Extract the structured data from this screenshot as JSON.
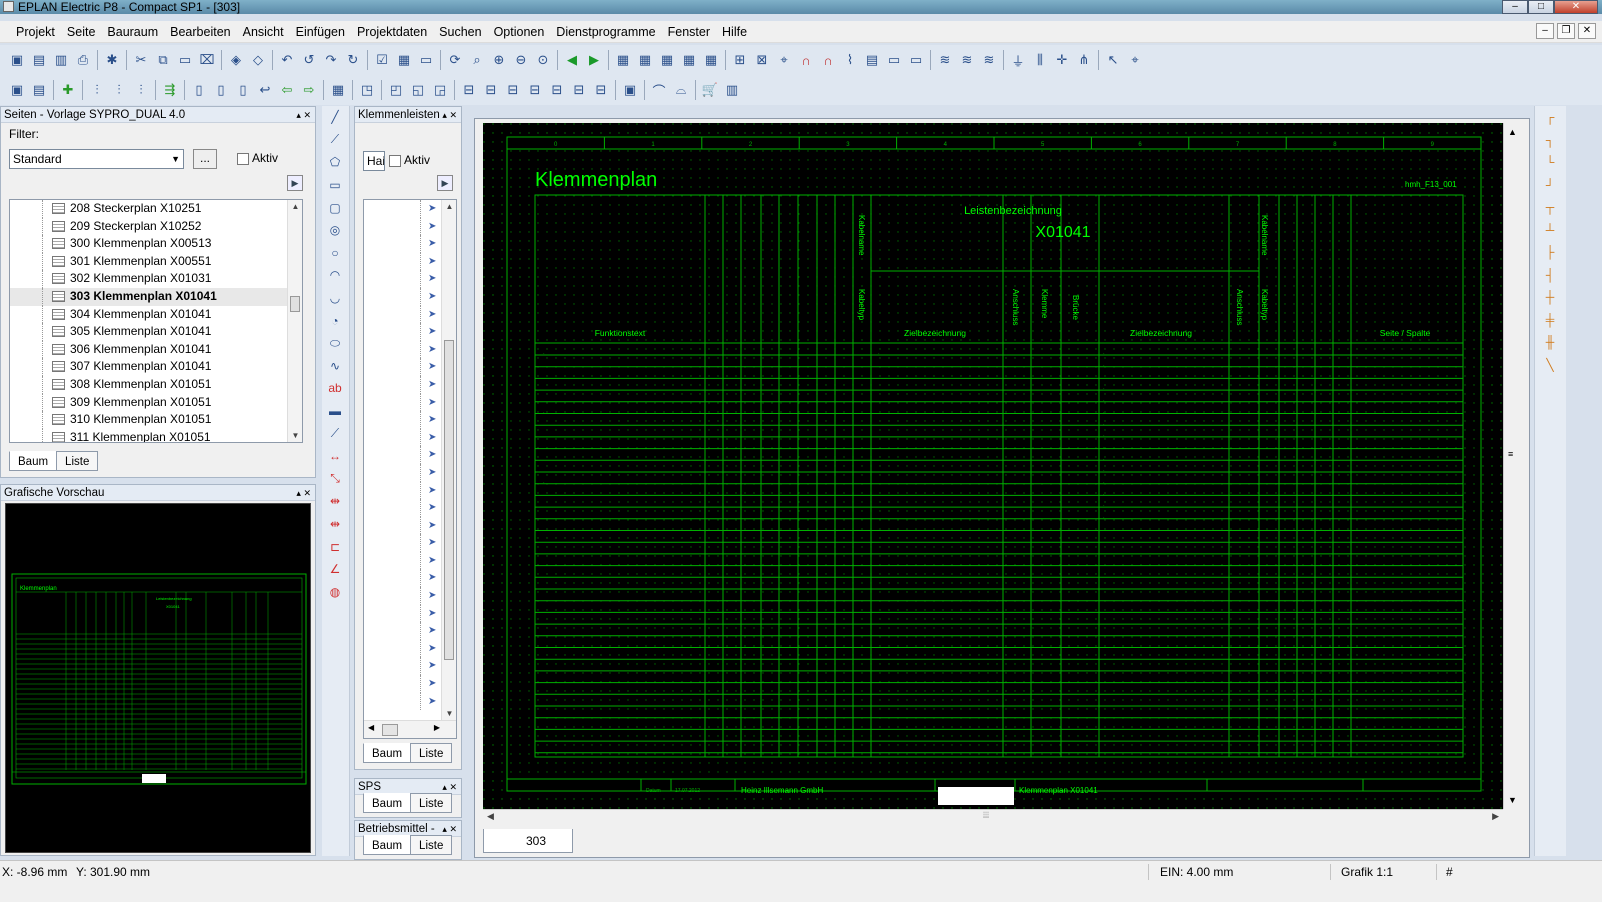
{
  "window": {
    "title": "EPLAN Electric P8 - Compact SP1 - [303]"
  },
  "menubar": {
    "items": [
      "Projekt",
      "Seite",
      "Bauraum",
      "Bearbeiten",
      "Ansicht",
      "Einfügen",
      "Projektdaten",
      "Suchen",
      "Optionen",
      "Dienstprogramme",
      "Fenster",
      "Hilfe"
    ]
  },
  "pages_panel": {
    "title": "Seiten - Vorlage SYPRO_DUAL 4.0",
    "filter_label": "Filter:",
    "filter_value": "Standard",
    "filter_more": "...",
    "active_label": "Aktiv",
    "items": [
      "208 Steckerplan X10251",
      "209 Steckerplan X10252",
      "300 Klemmenplan X00513",
      "301 Klemmenplan X00551",
      "302 Klemmenplan X01031",
      "303 Klemmenplan X01041",
      "304 Klemmenplan X01041",
      "305 Klemmenplan X01041",
      "306 Klemmenplan X01041",
      "307 Klemmenplan X01041",
      "308 Klemmenplan X01051",
      "309 Klemmenplan X01051",
      "310 Klemmenplan X01051",
      "311 Klemmenplan X01051"
    ],
    "selected_index": 5,
    "tabs": [
      "Baum",
      "Liste"
    ]
  },
  "preview_panel": {
    "title": "Grafische Vorschau",
    "mini_title": "Klemmenplan",
    "mini_heading": "Leistenbezeichnung",
    "mini_id": "X01041"
  },
  "terminal_panel": {
    "title": "Klemmenleisten",
    "filter_value": "Hai",
    "active_label": "Aktiv",
    "tabs": [
      "Baum",
      "Liste"
    ]
  },
  "sps_panel": {
    "title": "SPS",
    "tabs": [
      "Baum",
      "Liste"
    ]
  },
  "bm_panel": {
    "title": "Betriebsmittel -",
    "tabs": [
      "Baum",
      "Liste"
    ]
  },
  "drawing": {
    "title": "Klemmenplan",
    "form_name": "hmh_F13_001",
    "strip_heading": "Leistenbezeichnung",
    "strip_id": "X01041",
    "col_functiontext": "Funktionstext",
    "col_kabelname_left": "Kabelname",
    "col_kabeltyp_left": "Kabeltyp",
    "col_zielbez_left": "Zielbezeichnung",
    "col_anschluss_left": "Anschluss",
    "col_klemme": "Klemme",
    "col_bruecke": "Brücke",
    "col_zielbez_right": "Zielbezeichnung",
    "col_anschluss_right": "Anschluss",
    "col_kabelname_right": "Kabelname",
    "col_kabeltyp_right": "Kabeltyp",
    "col_seite": "Seite / Spalte",
    "footer_company": "Heinz Illsemann GmbH",
    "footer_title": "Klemmenplan X01041",
    "footer_date": "17.07.2012",
    "footer_date_label": "Datum",
    "ruler_numbers": [
      "0",
      "1",
      "2",
      "3",
      "4",
      "5",
      "6",
      "7",
      "8",
      "9"
    ],
    "page_tab": "303"
  },
  "statusbar": {
    "x": "X: -8.96 mm",
    "y": "Y: 301.90 mm",
    "ein": "EIN: 4.00 mm",
    "grafik": "Grafik 1:1",
    "hash": "#"
  },
  "colors": {
    "cad_green": "#00ff00",
    "cad_dark_green": "#00b000",
    "canvas_bg": "#000000"
  }
}
